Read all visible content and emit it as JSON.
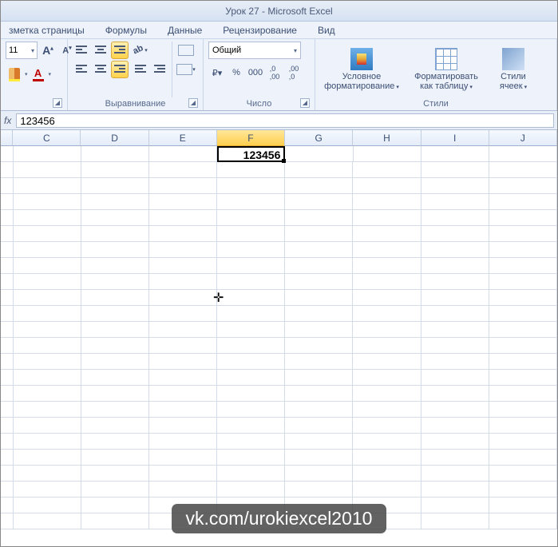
{
  "title": "Урок 27  -  Microsoft Excel",
  "tabs": [
    "зметка страницы",
    "Формулы",
    "Данные",
    "Рецензирование",
    "Вид"
  ],
  "font": {
    "size": "11"
  },
  "number_group": {
    "format": "Общий",
    "title": "Число"
  },
  "align_group": {
    "title": "Выравнивание"
  },
  "styles_group": {
    "title": "Стили",
    "conditional": "Условное форматирование",
    "as_table": "Форматировать как таблицу",
    "cell_styles": "Стили ячеек"
  },
  "formula_bar": {
    "value": "123456"
  },
  "columns": [
    "C",
    "D",
    "E",
    "F",
    "G",
    "H",
    "I",
    "J"
  ],
  "selected_col": "F",
  "active_cell": {
    "value": "123456"
  },
  "chart_data": {
    "type": "table",
    "rows": [
      {
        "F": 123456
      }
    ],
    "note": "single populated cell F (row 1)"
  },
  "watermark": "vk.com/urokiexcel2010"
}
